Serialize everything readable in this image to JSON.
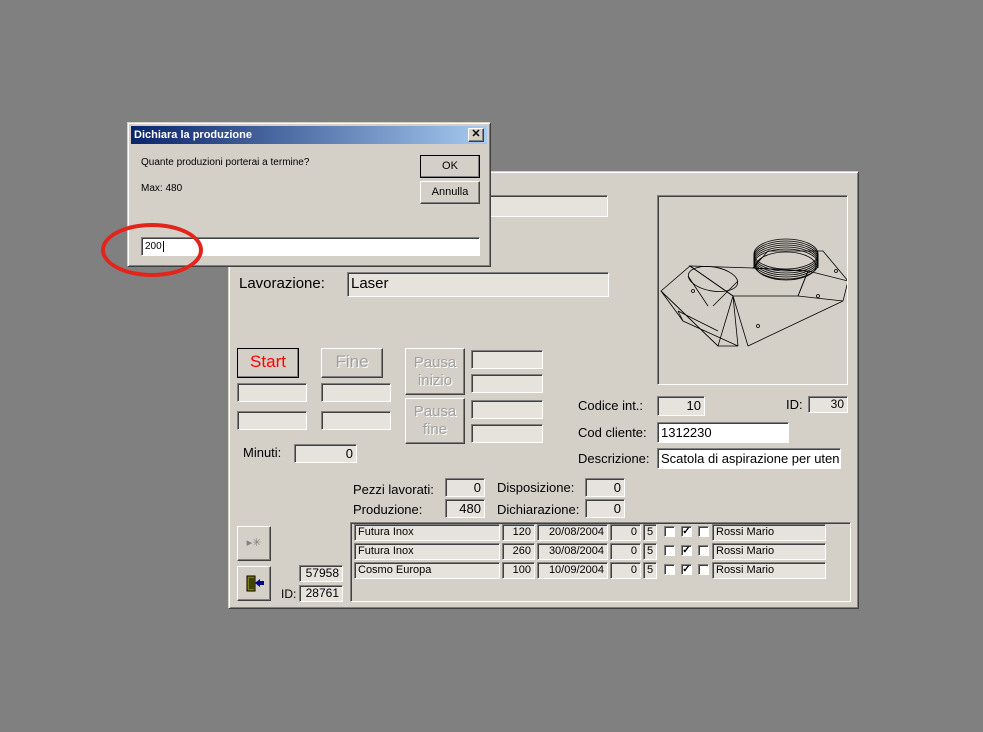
{
  "dialog": {
    "title": "Dichiara la produzione",
    "prompt": "Quante produzioni porterai a termine?",
    "max_text": "Max: 480",
    "ok_label": "OK",
    "cancel_label": "Annulla",
    "close_glyph": "✕",
    "input_value": "200"
  },
  "form": {
    "top_field_value": "",
    "lavorazione_label": "Lavorazione:",
    "lavorazione_value": "Laser",
    "start_label": "Start",
    "fine_label": "Fine",
    "pausa_inizio_label": "Pausa inizio",
    "pausa_fine_label": "Pausa fine",
    "minuti_label": "Minuti:",
    "minuti_value": "0",
    "codice_int_label": "Codice  int.:",
    "codice_int_value": "10",
    "id_label": "ID:",
    "id_value": "30",
    "cod_cliente_label": "Cod cliente:",
    "cod_cliente_value": "1312230",
    "descrizione_label": "Descrizione:",
    "descrizione_value": "Scatola di aspirazione per uten",
    "pezzi_label": "Pezzi lavorati:",
    "pezzi_value": "0",
    "disposizione_label": "Disposizione:",
    "disposizione_value": "0",
    "produzione_label": "Produzione:",
    "produzione_value": "480",
    "dichiarazione_label": "Dichiarazione:",
    "dichiarazione_value": "0",
    "record_number": "57958",
    "bottom_id_label": "ID:",
    "bottom_id_value": "28761"
  },
  "orders": [
    {
      "client": "Futura Inox",
      "qty": "120",
      "date": "20/08/2004",
      "n1": "0",
      "n2": "5",
      "c1": false,
      "c2": true,
      "c3": false,
      "operator": "Rossi Mario"
    },
    {
      "client": "Futura Inox",
      "qty": "260",
      "date": "30/08/2004",
      "n1": "0",
      "n2": "5",
      "c1": false,
      "c2": true,
      "c3": false,
      "operator": "Rossi Mario"
    },
    {
      "client": "Cosmo Europa",
      "qty": "100",
      "date": "10/09/2004",
      "n1": "0",
      "n2": "5",
      "c1": false,
      "c2": true,
      "c3": false,
      "operator": "Rossi Mario"
    }
  ],
  "icons": {
    "new_record": "new-record-icon",
    "exit": "exit-door-icon",
    "drawing": "cad-part-drawing"
  },
  "colors": {
    "desktop": "#808080",
    "start_text": "#ff0000",
    "title_gradient_start": "#0a246a",
    "title_gradient_end": "#a6caf0",
    "highlight_ellipse": "#e3241b"
  }
}
